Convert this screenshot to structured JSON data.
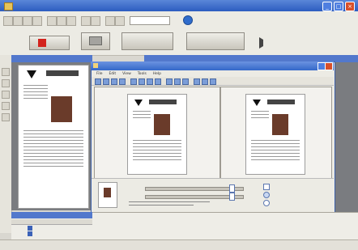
{
  "app": {
    "title": "",
    "dialog_title": "",
    "dialog_menu": [
      "File",
      "Edit",
      "View",
      "Tools",
      "Help"
    ]
  },
  "status_bar": {
    "left": "",
    "middle": ""
  },
  "dialog_buttons": {
    "b1": "",
    "b2": "",
    "b3": ""
  },
  "colors": {
    "title_blue": "#2c5cc0",
    "accent_red": "#d3231d",
    "panel_blue": "#5278cc"
  }
}
